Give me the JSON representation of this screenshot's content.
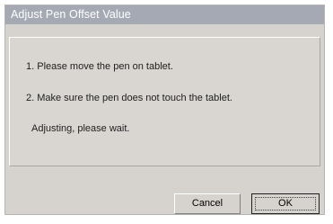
{
  "window": {
    "title": "Adjust Pen Offset Value"
  },
  "instructions": {
    "step1": "1. Please move the pen on tablet.",
    "step2": "2. Make sure the pen does not touch the tablet.",
    "status": "Adjusting, please wait."
  },
  "buttons": {
    "cancel_label": "Cancel",
    "ok_label": "OK"
  },
  "colors": {
    "titlebar": "#a4a9b4",
    "dialog_background": "#d6d3ce"
  }
}
